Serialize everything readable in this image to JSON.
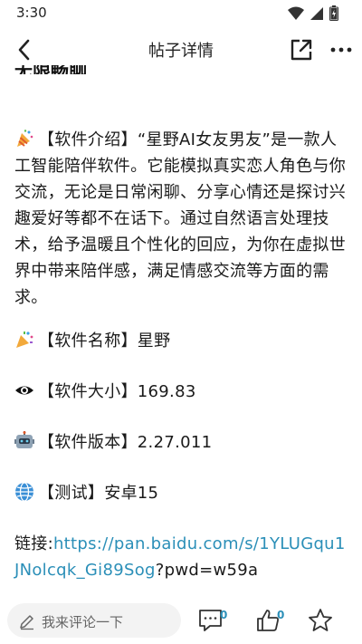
{
  "status": {
    "time": "3:30"
  },
  "nav": {
    "title": "帖子详情"
  },
  "post": {
    "clipped_heading": "无限畅聊",
    "intro_prefix": "【软件介绍】",
    "intro_text": "“星野AI女友男友”是一款人工智能陪伴软件。它能模拟真实恋人角色与你交流，无论是日常闲聊、分享心情还是探讨兴趣爱好等都不在话下。通过自然语言处理技术，给予温暖且个性化的回应，为你在虚拟世界中带来陪伴感，满足情感交流等方面的需求。",
    "name_line": "【软件名称】星野",
    "size_line": "【软件大小】169.83",
    "version_line": "【软件版本】2.27.011",
    "test_line": "【测试】安卓15",
    "link_label": "链接:",
    "link_url": "https://pan.baidu.com/s/1YLUGqu1JNolcqk_Gi89Sog",
    "link_suffix": "?pwd=w59a"
  },
  "bottom": {
    "comment_placeholder": "我来评论一下",
    "comment_count": "0",
    "like_count": "0"
  },
  "colors": {
    "link": "#2b8fb8",
    "count": "#2b8fb8"
  }
}
